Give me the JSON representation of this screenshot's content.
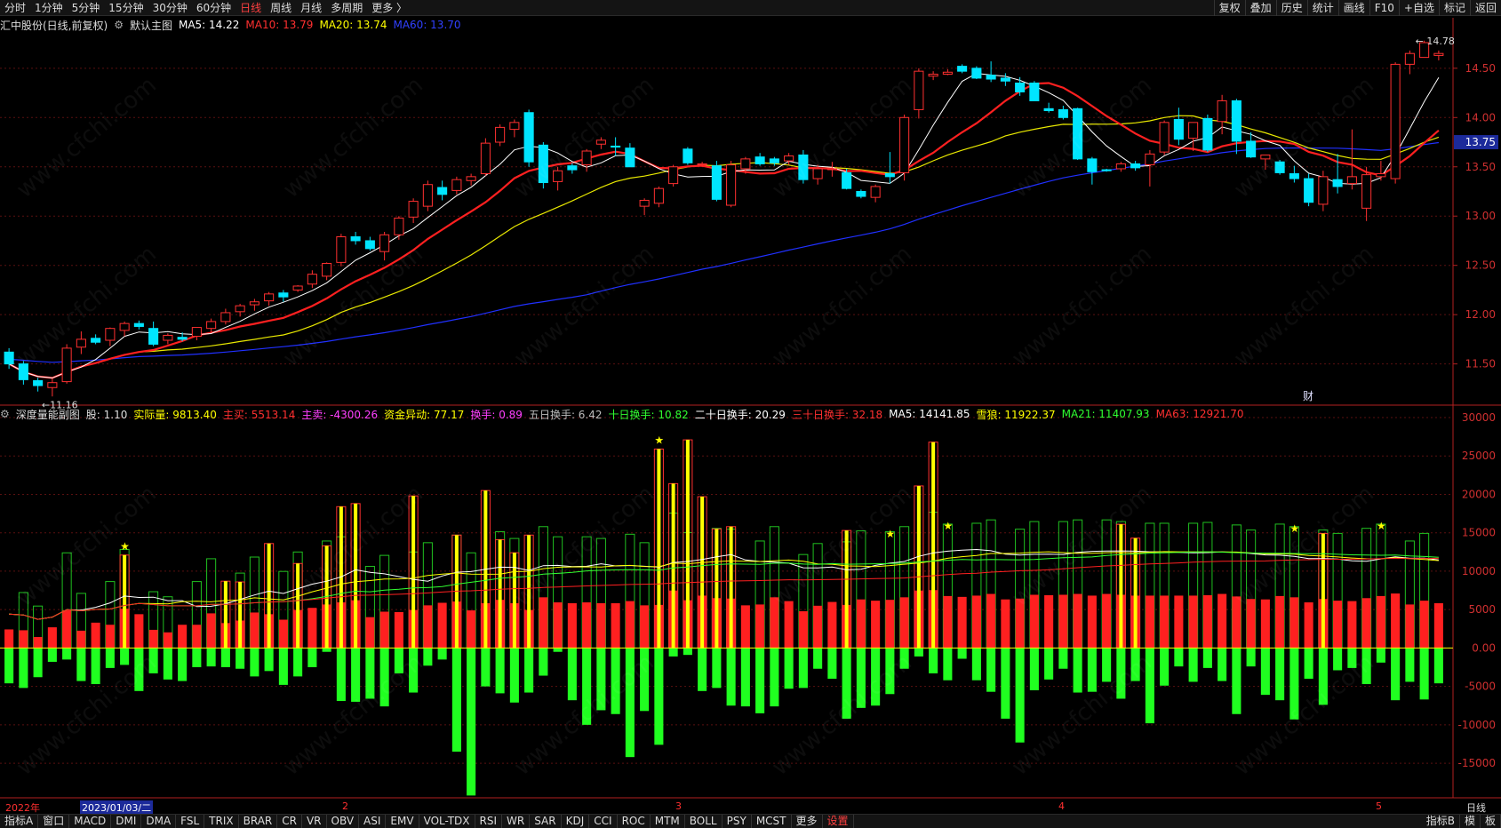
{
  "top_toolbar": {
    "periods": [
      "分时",
      "1分钟",
      "5分钟",
      "15分钟",
      "30分钟",
      "60分钟",
      "日线",
      "周线",
      "月线",
      "多周期",
      "更多 〉"
    ],
    "active_period": "日线",
    "right_buttons": [
      "复权",
      "叠加",
      "历史",
      "统计",
      "画线",
      "F10",
      "+自选",
      "标记",
      "返回"
    ]
  },
  "main_header": {
    "stock": "汇中股份(日线,前复权)",
    "template": "默认主图",
    "ma5": "MA5: 14.22",
    "ma10": "MA10: 13.79",
    "ma20": "MA20: 13.74",
    "ma60": "MA60: 13.70"
  },
  "sub_header": {
    "title": "深度量能副图",
    "items": [
      {
        "text": "股: 1.10",
        "color": "#dddddd"
      },
      {
        "text": "实际量: 9813.40",
        "color": "#ffff00"
      },
      {
        "text": "主买: 5513.14",
        "color": "#ff3030"
      },
      {
        "text": "主卖: -4300.26",
        "color": "#ff40ff"
      },
      {
        "text": "资金异动: 77.17",
        "color": "#ffff00"
      },
      {
        "text": "换手: 0.89",
        "color": "#ff40ff"
      },
      {
        "text": "五日换手: 6.42",
        "color": "#bbbbbb"
      },
      {
        "text": "十日换手: 10.82",
        "color": "#30ff30"
      },
      {
        "text": "二十日换手: 20.29",
        "color": "#ffffff"
      },
      {
        "text": "三十日换手: 32.18",
        "color": "#ff3030"
      },
      {
        "text": "MA5: 14141.85",
        "color": "#ffffff"
      },
      {
        "text": "雪狼: 11922.37",
        "color": "#ffff00"
      },
      {
        "text": "MA21: 11407.93",
        "color": "#30ff30"
      },
      {
        "text": "MA63: 12921.70",
        "color": "#ff3030"
      }
    ]
  },
  "price_axis": [
    "14.50",
    "14.00",
    "13.50",
    "13.00",
    "12.50",
    "12.00",
    "11.50"
  ],
  "current_price": "13.75",
  "high_marker": "14.78",
  "low_marker": "11.16",
  "finance_marker": "财",
  "volume_axis": [
    "30000",
    "25000",
    "20000",
    "15000",
    "10000",
    "5000",
    "0.00",
    "-5000",
    "-10000",
    "-15000"
  ],
  "date_labels": {
    "year": "2022年",
    "selected": "2023/01/03/二",
    "months": [
      "2",
      "3",
      "4",
      "5"
    ]
  },
  "period_label": "日线",
  "indicator_tabs": [
    "指标A",
    "窗口",
    "MACD",
    "DMI",
    "DMA",
    "FSL",
    "TRIX",
    "BRAR",
    "CR",
    "VR",
    "OBV",
    "ASI",
    "EMV",
    "VOL-TDX",
    "RSI",
    "WR",
    "SAR",
    "KDJ",
    "CCI",
    "ROC",
    "MTM",
    "BOLL",
    "PSY",
    "MCST",
    "更多",
    "设置"
  ],
  "active_tab": "设置",
  "bottom_right": [
    "指标B",
    "模",
    "板"
  ],
  "watermark": "www.cfchi.com",
  "colors": {
    "up": "#ff3030",
    "down": "#00e5ff",
    "ma5": "#ffffff",
    "ma10": "#ff2020",
    "ma20": "#e8e800",
    "ma60": "#2030ff",
    "vol_sell": "#20ff20"
  },
  "chart_data": {
    "type": "candlestick",
    "ylim": [
      11.1,
      14.85
    ],
    "ohlc": [
      [
        11.62,
        11.66,
        11.45,
        11.5
      ],
      [
        11.5,
        11.53,
        11.29,
        11.34
      ],
      [
        11.33,
        11.36,
        11.22,
        11.28
      ],
      [
        11.26,
        11.35,
        11.17,
        11.31
      ],
      [
        11.32,
        11.7,
        11.3,
        11.66
      ],
      [
        11.67,
        11.83,
        11.6,
        11.75
      ],
      [
        11.76,
        11.8,
        11.7,
        11.72
      ],
      [
        11.74,
        11.87,
        11.68,
        11.86
      ],
      [
        11.84,
        11.93,
        11.78,
        11.91
      ],
      [
        11.91,
        11.94,
        11.85,
        11.88
      ],
      [
        11.86,
        11.93,
        11.68,
        11.7
      ],
      [
        11.74,
        11.81,
        11.7,
        11.79
      ],
      [
        11.77,
        11.82,
        11.73,
        11.75
      ],
      [
        11.78,
        11.87,
        11.74,
        11.87
      ],
      [
        11.86,
        11.96,
        11.82,
        11.93
      ],
      [
        11.93,
        12.06,
        11.9,
        12.02
      ],
      [
        12.03,
        12.11,
        11.98,
        12.09
      ],
      [
        12.1,
        12.16,
        12.04,
        12.13
      ],
      [
        12.14,
        12.23,
        12.09,
        12.21
      ],
      [
        12.22,
        12.25,
        12.13,
        12.18
      ],
      [
        12.25,
        12.3,
        12.23,
        12.29
      ],
      [
        12.31,
        12.45,
        12.27,
        12.41
      ],
      [
        12.39,
        12.53,
        12.35,
        12.52
      ],
      [
        12.53,
        12.82,
        12.49,
        12.79
      ],
      [
        12.79,
        12.84,
        12.71,
        12.75
      ],
      [
        12.75,
        12.79,
        12.65,
        12.67
      ],
      [
        12.64,
        12.84,
        12.55,
        12.81
      ],
      [
        12.81,
        13.0,
        12.76,
        12.98
      ],
      [
        12.99,
        13.18,
        12.93,
        13.15
      ],
      [
        13.1,
        13.36,
        13.05,
        13.32
      ],
      [
        13.29,
        13.36,
        13.16,
        13.22
      ],
      [
        13.26,
        13.4,
        13.22,
        13.37
      ],
      [
        13.36,
        13.43,
        13.31,
        13.4
      ],
      [
        13.43,
        13.79,
        13.41,
        13.74
      ],
      [
        13.75,
        13.93,
        13.71,
        13.9
      ],
      [
        13.88,
        13.98,
        13.8,
        13.95
      ],
      [
        14.05,
        14.08,
        13.5,
        13.55
      ],
      [
        13.72,
        13.75,
        13.28,
        13.34
      ],
      [
        13.35,
        13.5,
        13.26,
        13.46
      ],
      [
        13.51,
        13.54,
        13.43,
        13.47
      ],
      [
        13.52,
        13.68,
        13.45,
        13.66
      ],
      [
        13.73,
        13.8,
        13.68,
        13.77
      ],
      [
        13.71,
        13.8,
        13.61,
        13.7
      ],
      [
        13.69,
        13.74,
        13.5,
        13.5
      ],
      [
        13.1,
        13.18,
        13.01,
        13.16
      ],
      [
        13.13,
        13.3,
        13.09,
        13.28
      ],
      [
        13.33,
        13.52,
        13.3,
        13.5
      ],
      [
        13.68,
        13.7,
        13.52,
        13.54
      ],
      [
        13.52,
        13.55,
        13.5,
        13.53
      ],
      [
        13.51,
        13.56,
        13.15,
        13.17
      ],
      [
        13.11,
        13.56,
        13.09,
        13.52
      ],
      [
        13.48,
        13.6,
        13.43,
        13.58
      ],
      [
        13.6,
        13.64,
        13.51,
        13.53
      ],
      [
        13.58,
        13.6,
        13.51,
        13.54
      ],
      [
        13.56,
        13.64,
        13.52,
        13.61
      ],
      [
        13.62,
        13.67,
        13.33,
        13.37
      ],
      [
        13.38,
        13.52,
        13.32,
        13.48
      ],
      [
        13.48,
        13.55,
        13.4,
        13.48
      ],
      [
        13.44,
        13.48,
        13.27,
        13.28
      ],
      [
        13.25,
        13.27,
        13.18,
        13.2
      ],
      [
        13.19,
        13.32,
        13.14,
        13.3
      ],
      [
        13.43,
        13.65,
        13.33,
        13.4
      ],
      [
        13.44,
        14.03,
        13.36,
        14.0
      ],
      [
        14.08,
        14.5,
        13.99,
        14.47
      ],
      [
        14.42,
        14.47,
        14.38,
        14.44
      ],
      [
        14.44,
        14.49,
        14.43,
        14.46
      ],
      [
        14.52,
        14.54,
        14.45,
        14.47
      ],
      [
        14.5,
        14.52,
        14.39,
        14.4
      ],
      [
        14.43,
        14.57,
        14.36,
        14.39
      ],
      [
        14.4,
        14.45,
        14.32,
        14.37
      ],
      [
        14.35,
        14.41,
        14.22,
        14.26
      ],
      [
        14.35,
        14.37,
        14.17,
        14.17
      ],
      [
        14.09,
        14.15,
        14.05,
        14.07
      ],
      [
        14.08,
        14.12,
        13.98,
        14.0
      ],
      [
        14.09,
        14.1,
        13.57,
        13.58
      ],
      [
        13.58,
        13.6,
        13.32,
        13.45
      ],
      [
        13.47,
        13.48,
        13.45,
        13.46
      ],
      [
        13.48,
        13.55,
        13.45,
        13.53
      ],
      [
        13.53,
        13.56,
        13.46,
        13.49
      ],
      [
        13.52,
        13.67,
        13.3,
        13.63
      ],
      [
        13.65,
        13.97,
        13.62,
        13.95
      ],
      [
        13.98,
        14.1,
        13.72,
        13.78
      ],
      [
        13.79,
        13.95,
        13.66,
        13.95
      ],
      [
        13.99,
        14.03,
        13.65,
        13.67
      ],
      [
        13.96,
        14.23,
        13.83,
        14.17
      ],
      [
        14.17,
        14.19,
        13.63,
        13.76
      ],
      [
        13.76,
        13.85,
        13.59,
        13.6
      ],
      [
        13.58,
        13.62,
        13.47,
        13.62
      ],
      [
        13.55,
        13.57,
        13.42,
        13.44
      ],
      [
        13.43,
        13.51,
        13.34,
        13.38
      ],
      [
        13.38,
        13.43,
        13.1,
        13.14
      ],
      [
        13.12,
        13.46,
        13.05,
        13.4
      ],
      [
        13.37,
        13.63,
        13.23,
        13.3
      ],
      [
        13.33,
        13.88,
        13.27,
        13.4
      ],
      [
        13.08,
        13.5,
        12.95,
        13.42
      ],
      [
        13.4,
        13.56,
        13.36,
        13.43
      ],
      [
        13.38,
        14.56,
        13.33,
        14.54
      ],
      [
        14.54,
        14.68,
        14.44,
        14.65
      ],
      [
        14.61,
        14.78,
        14.61,
        14.76
      ],
      [
        14.63,
        14.68,
        14.58,
        14.65
      ]
    ],
    "volume_range": [
      -19500,
      30000
    ],
    "buy_volume": [
      4.4,
      4.2,
      2.6,
      4.9,
      8.9,
      4.1,
      6.0,
      5.5,
      9.3,
      8.0,
      4.3,
      3.7,
      5.5,
      5.5,
      8.2,
      5.9,
      6.5,
      8.4,
      8.0,
      6.7,
      9.0,
      9.5,
      10.3,
      10.8,
      11.3,
      7.3,
      8.6,
      8.5,
      9.0,
      10.1,
      10.7,
      11.0,
      8.9,
      10.6,
      11.4,
      10.6,
      9.0,
      12.0,
      10.8,
      10.6,
      10.8,
      10.6,
      10.6,
      11.1,
      10.1,
      10.2,
      13.6,
      11.3,
      12.4,
      11.8,
      11.7,
      10.1,
      10.3,
      12.0,
      11.1,
      8.7,
      10.0,
      10.9,
      10.2,
      11.5,
      11.2,
      11.4,
      12.0,
      13.6,
      13.7,
      12.3,
      12.1,
      12.4,
      12.8,
      11.5,
      11.7,
      12.6,
      12.5,
      12.6,
      12.8,
      12.4,
      12.8,
      12.6,
      12.4,
      12.4,
      12.4,
      12.4,
      12.4,
      12.5,
      12.8,
      12.2,
      11.6,
      11.5,
      12.3,
      12.0,
      10.8,
      11.6,
      11.2,
      11.1,
      11.8,
      12.3,
      12.9,
      10.3,
      11.2,
      10.6
    ],
    "sell_volume": [
      -4.6,
      -5.2,
      -3.8,
      -1.8,
      -1.5,
      -4.3,
      -4.7,
      -2.6,
      -2.2,
      -5.6,
      -3.3,
      -4.1,
      -4.3,
      -2.5,
      -2.4,
      -2.5,
      -2.7,
      -3.7,
      -3.0,
      -4.8,
      -3.7,
      -2.5,
      -0.5,
      -6.9,
      -7.0,
      -6.6,
      -7.6,
      -3.3,
      -5.8,
      -2.3,
      -1.5,
      -13.5,
      -19.2,
      -5.0,
      -5.9,
      -7.1,
      -5.8,
      -3.6,
      -0.5,
      -6.8,
      -10.0,
      -8.1,
      -8.6,
      -14.2,
      -8.2,
      -12.6,
      -1.1,
      -0.9,
      -5.6,
      -5.2,
      -7.5,
      -7.6,
      -8.5,
      -7.6,
      -5.3,
      -5.2,
      -2.7,
      -4.0,
      -9.2,
      -7.8,
      -7.5,
      -6.0,
      -2.7,
      -1.1,
      -3.3,
      -4.2,
      -1.4,
      -4.2,
      -5.7,
      -9.2,
      -12.3,
      -5.5,
      -4.1,
      -2.7,
      -5.8,
      -5.7,
      -4.4,
      -6.6,
      -4.3,
      -9.8,
      -4.9,
      -2.4,
      -4.4,
      -2.6,
      -4.3,
      -8.6,
      -2.4,
      -6.1,
      -6.8,
      -9.3,
      -4.0,
      -7.4,
      -2.9,
      -2.6,
      -4.7,
      -1.9,
      -6.8,
      -4.4,
      -6.7,
      -4.6
    ],
    "total_volume_highlight": [
      null,
      null,
      null,
      null,
      null,
      null,
      null,
      null,
      12.1,
      null,
      null,
      null,
      null,
      null,
      null,
      8.7,
      8.6,
      null,
      13.6,
      null,
      11.0,
      null,
      13.3,
      18.4,
      18.8,
      null,
      null,
      null,
      19.8,
      null,
      null,
      14.7,
      null,
      20.5,
      14.1,
      12.4,
      14.7,
      null,
      null,
      null,
      null,
      null,
      null,
      null,
      null,
      25.9,
      21.4,
      27.1,
      19.7,
      15.5,
      15.8,
      null,
      null,
      null,
      null,
      null,
      null,
      null,
      15.3,
      null,
      null,
      null,
      null,
      21.1,
      26.8,
      null,
      null,
      null,
      null,
      null,
      null,
      null,
      null,
      null,
      null,
      null,
      null,
      16.1,
      14.3,
      null,
      null,
      null,
      null,
      null,
      null,
      null,
      null,
      null,
      null,
      null,
      null,
      14.9,
      null,
      null,
      null,
      null,
      null,
      null,
      null,
      null
    ],
    "ma_lines": [
      "MA5",
      "MA10",
      "MA20",
      "MA60"
    ]
  }
}
